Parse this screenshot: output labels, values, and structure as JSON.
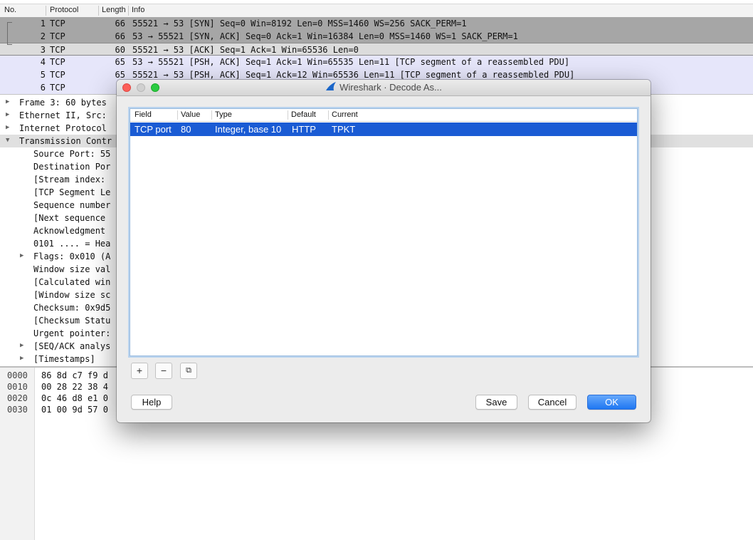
{
  "packet_list": {
    "columns": [
      "No.",
      "Protocol",
      "Length",
      "Info"
    ],
    "rows": [
      {
        "no": "1",
        "protocol": "TCP",
        "length": "66",
        "info": "55521 → 53 [SYN] Seq=0 Win=8192 Len=0 MSS=1460 WS=256 SACK_PERM=1"
      },
      {
        "no": "2",
        "protocol": "TCP",
        "length": "66",
        "info": "53 → 55521 [SYN, ACK] Seq=0 Ack=1 Win=16384 Len=0 MSS=1460 WS=1 SACK_PERM=1"
      },
      {
        "no": "3",
        "protocol": "TCP",
        "length": "60",
        "info": "55521 → 53 [ACK] Seq=1 Ack=1 Win=65536 Len=0"
      },
      {
        "no": "4",
        "protocol": "TCP",
        "length": "65",
        "info": "53 → 55521 [PSH, ACK] Seq=1 Ack=1 Win=65535 Len=11 [TCP segment of a reassembled PDU]"
      },
      {
        "no": "5",
        "protocol": "TCP",
        "length": "65",
        "info": "55521 → 53 [PSH, ACK] Seq=1 Ack=12 Win=65536 Len=11 [TCP segment of a reassembled PDU]"
      },
      {
        "no": "6",
        "protocol": "TCP",
        "length": "6",
        "info": ""
      }
    ]
  },
  "details": [
    {
      "text": "Frame 3: 60 bytes",
      "expander": "▶"
    },
    {
      "text": "Ethernet II, Src:",
      "expander": "▶"
    },
    {
      "text": "Internet Protocol",
      "expander": "▶"
    },
    {
      "text": "Transmission Contr",
      "expander": "▼"
    },
    {
      "text": "Source Port: 55",
      "expander": ""
    },
    {
      "text": "Destination Por",
      "expander": ""
    },
    {
      "text": "[Stream index:",
      "expander": ""
    },
    {
      "text": "[TCP Segment Le",
      "expander": ""
    },
    {
      "text": "Sequence number",
      "expander": ""
    },
    {
      "text": "[Next sequence",
      "expander": ""
    },
    {
      "text": "Acknowledgment",
      "expander": ""
    },
    {
      "text": "0101 .... = Hea",
      "expander": ""
    },
    {
      "text": "Flags: 0x010 (A",
      "expander": "▶"
    },
    {
      "text": "Window size val",
      "expander": ""
    },
    {
      "text": "[Calculated win",
      "expander": ""
    },
    {
      "text": "[Window size sc",
      "expander": ""
    },
    {
      "text": "Checksum: 0x9d5",
      "expander": ""
    },
    {
      "text": "[Checksum Statu",
      "expander": ""
    },
    {
      "text": "Urgent pointer:",
      "expander": ""
    },
    {
      "text": "[SEQ/ACK analys",
      "expander": "▶"
    },
    {
      "text": "[Timestamps]",
      "expander": "▶"
    }
  ],
  "bytes": [
    {
      "offset": "0000",
      "hex": "86 8d c7 f9 d"
    },
    {
      "offset": "0010",
      "hex": "00 28 22 38 4"
    },
    {
      "offset": "0020",
      "hex": "0c 46 d8 e1 0"
    },
    {
      "offset": "0030",
      "hex": "01 00 9d 57 0"
    }
  ],
  "dialog": {
    "title": "Wireshark · Decode As...",
    "columns": [
      "Field",
      "Value",
      "Type",
      "Default",
      "Current"
    ],
    "entry": {
      "field": "TCP port",
      "value": "80",
      "type": "Integer, base 10",
      "default": "HTTP",
      "current": "TPKT"
    },
    "tool_buttons": {
      "add": "+",
      "remove": "−",
      "copy": "⧉"
    },
    "buttons": {
      "help": "Help",
      "save": "Save",
      "cancel": "Cancel",
      "ok": "OK"
    }
  },
  "colors": {
    "accent": "#1a5bd4",
    "ok_button": "#1f77f2",
    "row_highlight": "#e6e6fa"
  }
}
